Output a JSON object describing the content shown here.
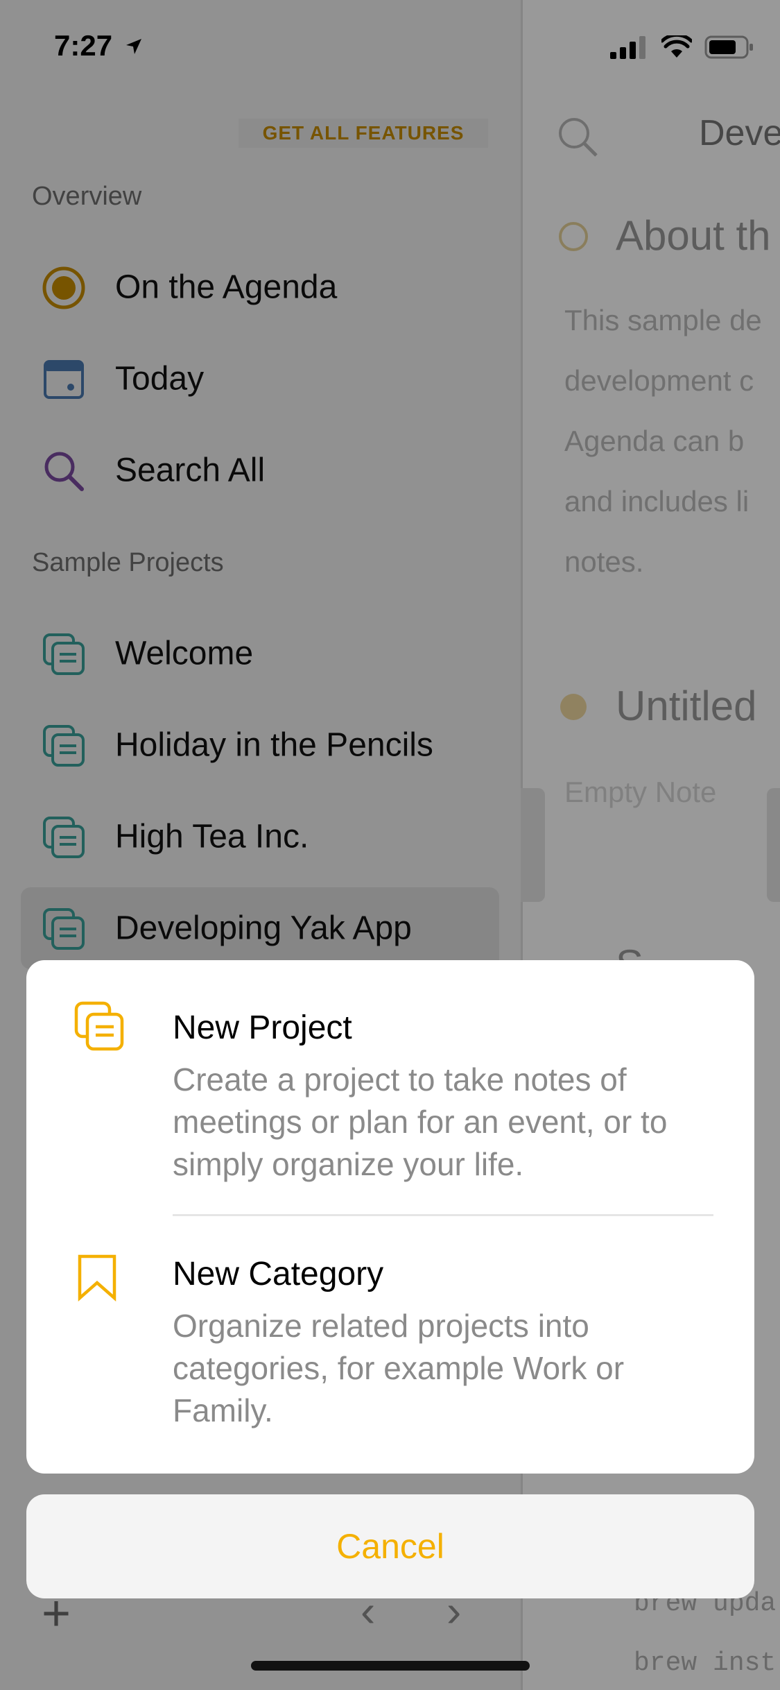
{
  "status_bar": {
    "time": "7:27"
  },
  "sidebar": {
    "features_button": "GET ALL FEATURES",
    "overview_label": "Overview",
    "overview_items": [
      {
        "label": "On the Agenda",
        "icon": "agenda-icon"
      },
      {
        "label": "Today",
        "icon": "calendar-icon"
      },
      {
        "label": "Search All",
        "icon": "search-icon"
      }
    ],
    "projects_label": "Sample Projects",
    "project_items": [
      {
        "label": "Welcome",
        "icon": "project-icon"
      },
      {
        "label": "Holiday in the Pencils",
        "icon": "project-icon"
      },
      {
        "label": "High Tea Inc.",
        "icon": "project-icon"
      },
      {
        "label": "Developing Yak App",
        "icon": "project-icon",
        "selected": true
      }
    ]
  },
  "main": {
    "header_title": "Deve",
    "note1_title": "About th",
    "note1_lines": [
      "This sample de",
      "development c",
      "Agenda can b",
      "and includes li",
      "notes."
    ],
    "note2_title": "Untitled",
    "note2_placeholder": "Empty Note",
    "note3_title": "S",
    "code_lines": [
      "brew upda",
      "brew inst"
    ]
  },
  "sheet": {
    "items": [
      {
        "title": "New Project",
        "description": "Create a project to take notes of meetings or plan for an event, or to simply organize your life.",
        "icon": "project-icon"
      },
      {
        "title": "New Category",
        "description": "Organize related projects into categories, for example Work or Family.",
        "icon": "bookmark-icon"
      }
    ],
    "cancel_label": "Cancel"
  },
  "colors": {
    "accent": "#f4b000",
    "agenda": "#c68c00",
    "project": "#3aa09a",
    "calendar": "#4a78b0",
    "search": "#7a4aa0"
  }
}
